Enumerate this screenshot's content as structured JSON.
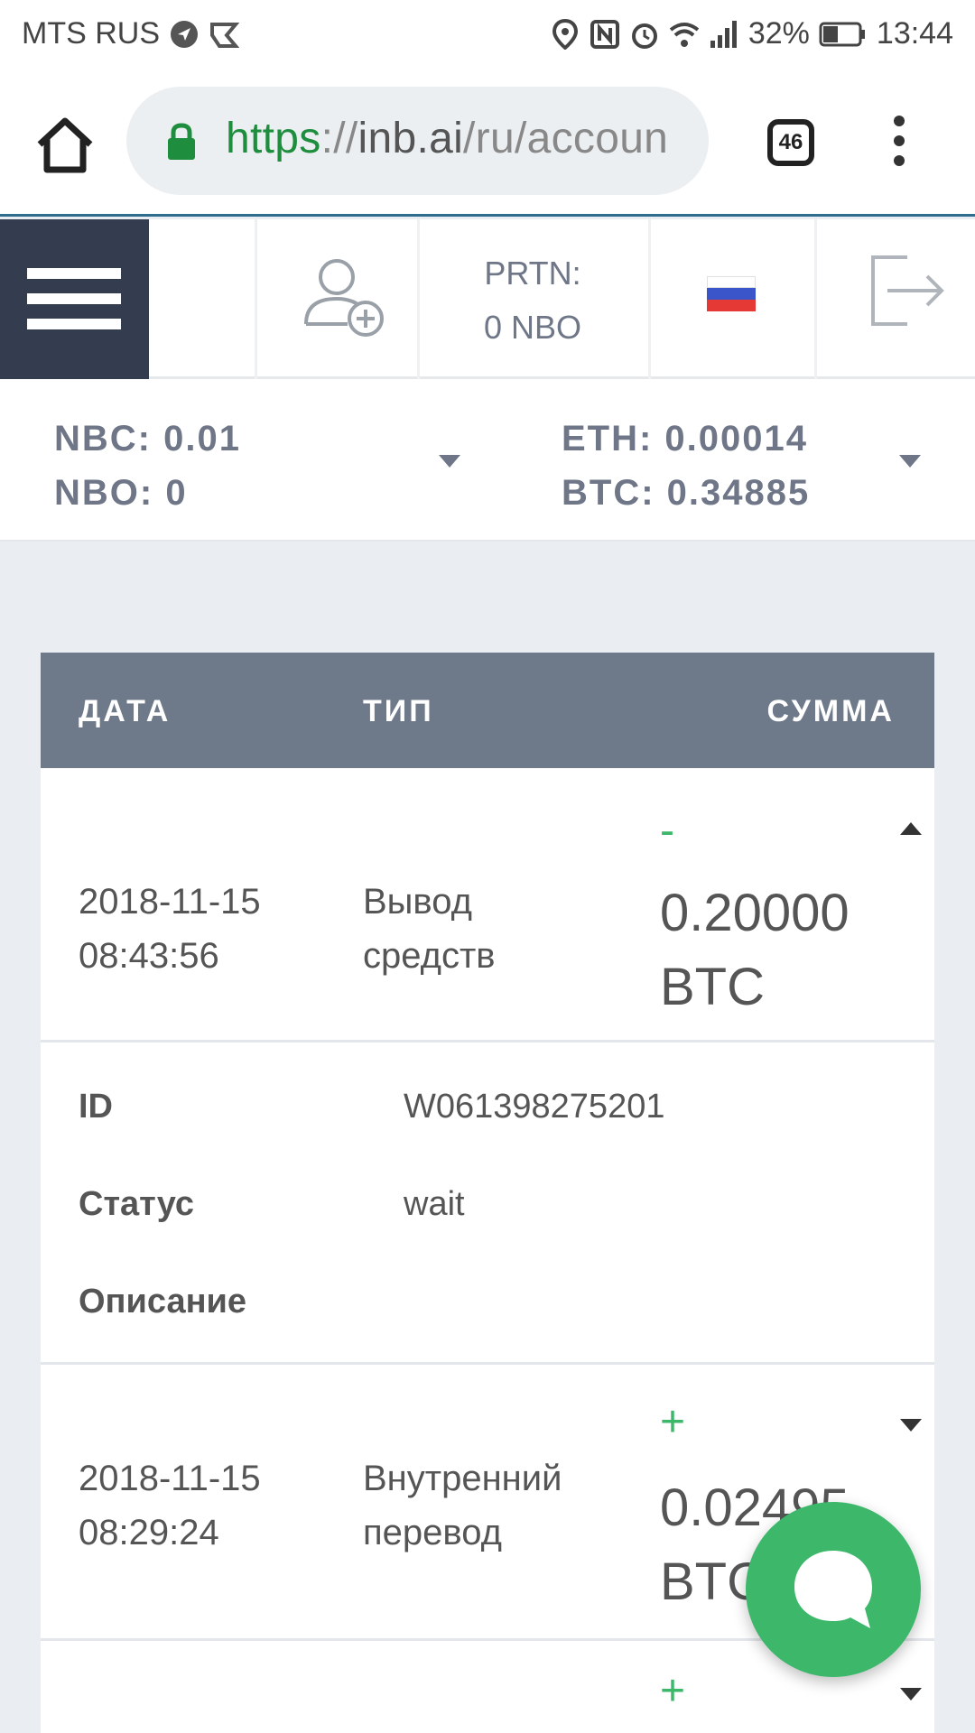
{
  "status_bar": {
    "carrier": "MTS RUS",
    "battery": "32%",
    "time": "13:44"
  },
  "browser": {
    "url_scheme": "https",
    "url_sep": "://",
    "url_host": "inb.ai",
    "url_path": "/ru/accoun",
    "tab_count": "46"
  },
  "header": {
    "prtn_label": "PRTN:",
    "prtn_value": "0 NBO"
  },
  "balances": {
    "left": [
      "NBC: 0.01",
      "NBO: 0"
    ],
    "right": [
      "ETH: 0.00014",
      "BTC: 0.34885"
    ]
  },
  "table": {
    "columns": [
      "ДАТА",
      "ТИП",
      "СУММА"
    ],
    "rows": [
      {
        "date": "2018-11-15",
        "time": "08:43:56",
        "type_line1": "Вывод",
        "type_line2": "средств",
        "sign": "-",
        "amount": "0.20000",
        "currency": "BTC",
        "expanded": true
      },
      {
        "date": "2018-11-15",
        "time": "08:29:24",
        "type_line1": "Внутренний",
        "type_line2": "перевод",
        "sign": "+",
        "amount": "0.02495",
        "currency": "BTC",
        "expanded": false
      },
      {
        "sign": "+"
      }
    ],
    "details": {
      "id_label": "ID",
      "id_value": "W061398275201",
      "status_label": "Статус",
      "status_value": "wait",
      "description_label": "Описание"
    }
  },
  "colors": {
    "accent_green": "#3db86b",
    "nav_dark": "#343d4f",
    "table_header": "#6e7a8a",
    "muted_text": "#6e7687"
  },
  "icons": [
    "navigation-icon",
    "nfc-icon",
    "alarm-icon",
    "wifi-icon",
    "signal-icon",
    "battery-icon",
    "home-icon",
    "lock-icon",
    "add-user-icon",
    "ru-flag-icon",
    "logout-icon",
    "chat-icon"
  ]
}
